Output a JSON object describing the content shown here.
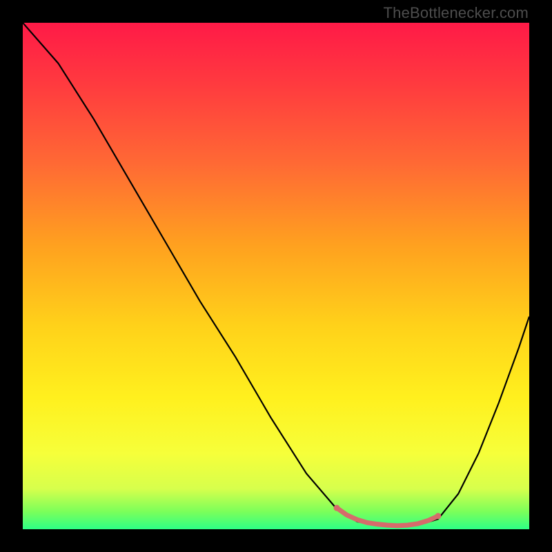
{
  "watermark": "TheBottlenecker.com",
  "chart_data": {
    "type": "line",
    "title": "",
    "xlabel": "",
    "ylabel": "",
    "xlim": [
      0,
      100
    ],
    "ylim": [
      0,
      100
    ],
    "grid": false,
    "series": [
      {
        "name": "curve",
        "color": "#000000",
        "x": [
          0,
          7,
          14,
          21,
          28,
          35,
          42,
          49,
          56,
          62,
          66,
          70,
          74,
          78,
          82,
          86,
          90,
          94,
          98,
          100
        ],
        "y": [
          100,
          92,
          81,
          69,
          57,
          45,
          34,
          22,
          11,
          4,
          1.5,
          0.8,
          0.6,
          0.8,
          2,
          7,
          15,
          25,
          36,
          42
        ]
      },
      {
        "name": "highlight-band",
        "color": "#d66b6b",
        "x": [
          62,
          64,
          66,
          68,
          70,
          72,
          74,
          76,
          78,
          80,
          82
        ],
        "y": [
          4.2,
          2.8,
          1.9,
          1.3,
          1.0,
          0.8,
          0.7,
          0.8,
          1.1,
          1.7,
          2.6
        ]
      }
    ],
    "background_gradient": {
      "type": "vertical",
      "stops": [
        {
          "offset": 0.0,
          "color": "#ff1a47"
        },
        {
          "offset": 0.12,
          "color": "#ff3a3f"
        },
        {
          "offset": 0.28,
          "color": "#ff6a34"
        },
        {
          "offset": 0.44,
          "color": "#ffa11f"
        },
        {
          "offset": 0.6,
          "color": "#ffd21a"
        },
        {
          "offset": 0.74,
          "color": "#fff01e"
        },
        {
          "offset": 0.85,
          "color": "#f6ff3a"
        },
        {
          "offset": 0.92,
          "color": "#d7ff4c"
        },
        {
          "offset": 0.965,
          "color": "#7cff5a"
        },
        {
          "offset": 1.0,
          "color": "#2dff86"
        }
      ]
    }
  }
}
